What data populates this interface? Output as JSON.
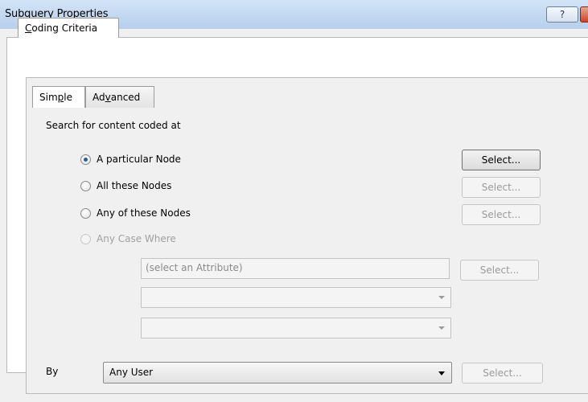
{
  "window": {
    "title": "Subquery Properties",
    "help_label": "?"
  },
  "outer_tabs": [
    {
      "label": "Coding Criteria",
      "mnemonic": "C",
      "rest": "oding Criteria"
    }
  ],
  "inner_tabs": [
    {
      "label": "Simple",
      "pre": "Sim",
      "mnemonic": "p",
      "post": "le"
    },
    {
      "label": "Advanced",
      "pre": "Ad",
      "mnemonic": "v",
      "post": "anced"
    }
  ],
  "simple": {
    "search_label": "Search for content coded at",
    "options": [
      {
        "label": "A particular Node",
        "checked": true,
        "enabled": true
      },
      {
        "label": "All these Nodes",
        "checked": false,
        "enabled": true
      },
      {
        "label": "Any of these Nodes",
        "checked": false,
        "enabled": true
      },
      {
        "label": "Any Case Where",
        "checked": false,
        "enabled": false
      }
    ],
    "select_buttons": [
      "Select...",
      "Select...",
      "Select...",
      "Select..."
    ],
    "attribute_placeholder": "(select an Attribute)",
    "by_label": "By",
    "user_value": "Any User",
    "user_select_button": "Select..."
  }
}
